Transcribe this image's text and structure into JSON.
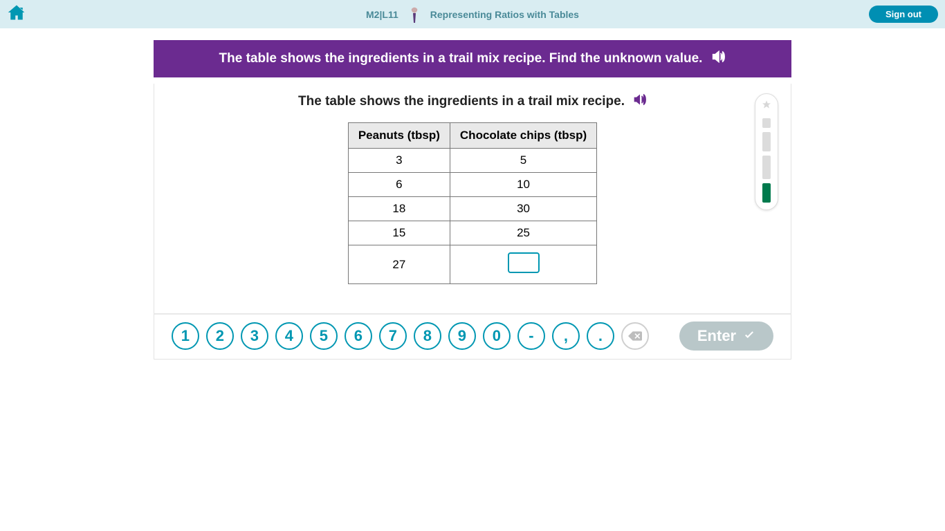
{
  "header": {
    "level_badge": "M2|L11",
    "lesson_title": "Representing Ratios with Tables",
    "sign_out_label": "Sign out"
  },
  "instruction": "The table shows the ingredients in a trail mix recipe. Find the unknown value.",
  "subprompt": "The table shows the ingredients in a trail mix recipe.",
  "table": {
    "col1_header": "Peanuts (tbsp)",
    "col2_header": "Chocolate chips (tbsp)",
    "rows": [
      {
        "c1": "3",
        "c2": "5"
      },
      {
        "c1": "6",
        "c2": "10"
      },
      {
        "c1": "18",
        "c2": "30"
      },
      {
        "c1": "15",
        "c2": "25"
      },
      {
        "c1": "27",
        "c2": ""
      }
    ],
    "answer_row_index": 4
  },
  "keypad": {
    "k1": "1",
    "k2": "2",
    "k3": "3",
    "k4": "4",
    "k5": "5",
    "k6": "6",
    "k7": "7",
    "k8": "8",
    "k9": "9",
    "k0": "0",
    "minus": "-",
    "comma": ",",
    "period": ".",
    "enter_label": "Enter"
  },
  "colors": {
    "accent_teal": "#0097b2",
    "purple_bar": "#6b2b90",
    "header_bg": "#d9edf2",
    "progress_green": "#007a4d"
  }
}
